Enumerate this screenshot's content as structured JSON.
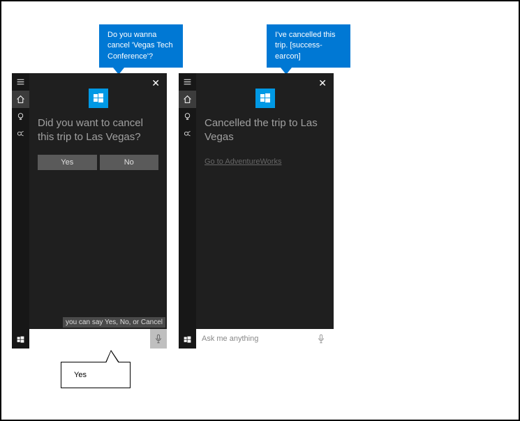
{
  "bubbles": {
    "left_top": "Do you wanna cancel 'Vegas Tech Conference'?",
    "right_top": "I've cancelled this trip. [success-earcon]",
    "left_bottom": "Yes"
  },
  "panel_left": {
    "question": "Did you want to cancel this trip to Las Vegas?",
    "yes_label": "Yes",
    "no_label": "No",
    "hint": "you can say Yes, No, or Cancel",
    "input_value": ""
  },
  "panel_right": {
    "question": "Cancelled the trip to Las Vegas",
    "link_label": "Go to AdventureWorks",
    "input_placeholder": "Ask me anything"
  }
}
